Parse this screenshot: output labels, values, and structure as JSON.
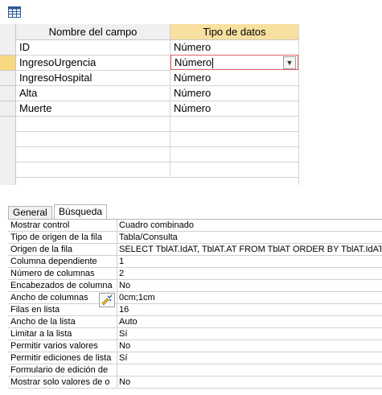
{
  "grid": {
    "headers": {
      "field_name": "Nombre del campo",
      "data_type": "Tipo de datos"
    },
    "rows": [
      {
        "name": "ID",
        "type": "Número"
      },
      {
        "name": "IngresoUrgencia",
        "type": "Número"
      },
      {
        "name": "IngresoHospital",
        "type": "Número"
      },
      {
        "name": "Alta",
        "type": "Número"
      },
      {
        "name": "Muerte",
        "type": "Número"
      }
    ],
    "active_row_index": 1,
    "icons": {
      "table": "table-icon",
      "dropdown": "chevron-down-icon"
    }
  },
  "properties": {
    "tabs": [
      {
        "label": "General",
        "selected": false
      },
      {
        "label": "Búsqueda",
        "selected": true
      }
    ],
    "rows": [
      {
        "label": "Mostrar control",
        "value": "Cuadro combinado"
      },
      {
        "label": "Tipo de origen de la fila",
        "value": "Tabla/Consulta"
      },
      {
        "label": "Origen de la fila",
        "value": "SELECT TblAT.IdAT, TblAT.AT FROM TblAT ORDER BY TblAT.IdAT;"
      },
      {
        "label": "Columna dependiente",
        "value": "1"
      },
      {
        "label": "Número de columnas",
        "value": "2"
      },
      {
        "label": "Encabezados de columna",
        "value": "No"
      },
      {
        "label": "Ancho de columnas",
        "value": "0cm;1cm"
      },
      {
        "label": "Filas en lista",
        "value": "16"
      },
      {
        "label": "Ancho de la lista",
        "value": "Auto"
      },
      {
        "label": "Limitar a la lista",
        "value": "Sí"
      },
      {
        "label": "Permitir varios valores",
        "value": "No"
      },
      {
        "label": "Permitir ediciones de lista",
        "value": "Sí"
      },
      {
        "label": "Formulario de edición de",
        "value": ""
      },
      {
        "label": "Mostrar solo valores de o",
        "value": "No"
      }
    ],
    "icons": {
      "builder": "build-icon"
    }
  },
  "colors": {
    "active_header": "#f8e0a0",
    "active_selector": "#f8d880",
    "active_cell_border": "#e06060",
    "grid_line": "#d4d4d4"
  }
}
